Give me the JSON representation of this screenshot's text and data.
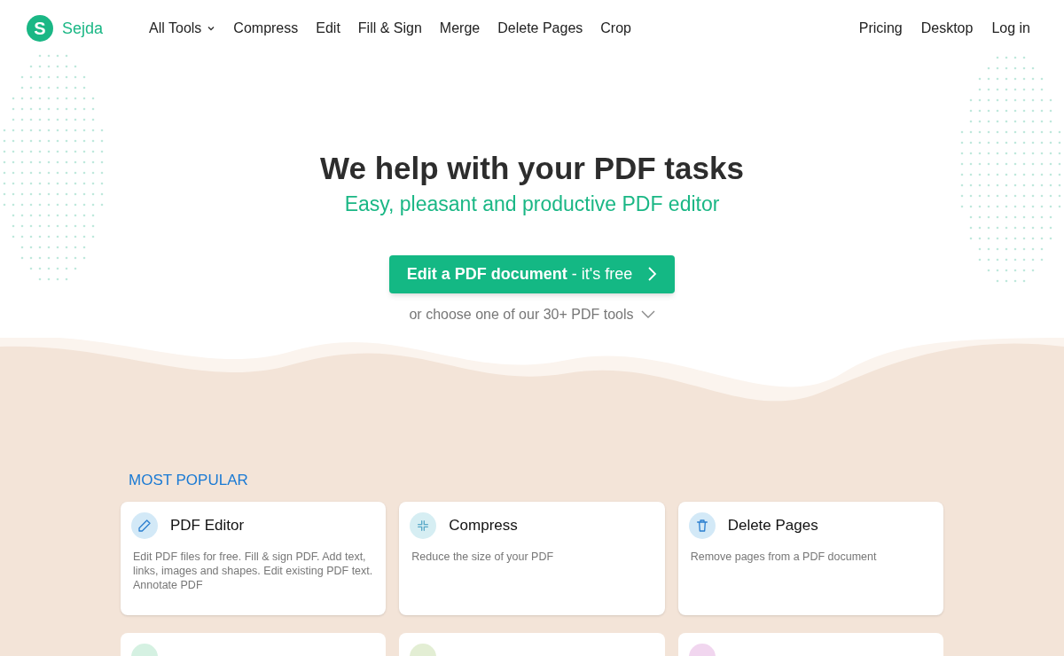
{
  "logo": {
    "text": "Sejda",
    "letter": "S"
  },
  "nav": [
    {
      "label": "All Tools",
      "dropdown": true
    },
    {
      "label": "Compress",
      "dropdown": false
    },
    {
      "label": "Edit",
      "dropdown": false
    },
    {
      "label": "Fill & Sign",
      "dropdown": false
    },
    {
      "label": "Merge",
      "dropdown": false
    },
    {
      "label": "Delete Pages",
      "dropdown": false
    },
    {
      "label": "Crop",
      "dropdown": false
    }
  ],
  "nav_right": [
    "Pricing",
    "Desktop",
    "Log in"
  ],
  "hero": {
    "title": "We help with your PDF tasks",
    "subtitle": "Easy, pleasant and productive PDF editor",
    "cta": "**Edit a PDF document** - it's free",
    "more": "or choose one of our 30+ PDF tools"
  },
  "section_title": "MOST POPULAR",
  "cards": [
    {
      "kind": "pencil",
      "title": "PDF Editor",
      "description": "Edit PDF files for free. Fill & sign PDF. Add text, links, images and shapes. Edit existing PDF text. Annotate PDF",
      "color": "#d3e9f7"
    },
    {
      "kind": "compress",
      "title": "Compress",
      "description": "Reduce the size of your PDF",
      "color": "#d6eef3"
    },
    {
      "kind": "trash",
      "title": "Delete Pages",
      "description": "Remove pages from a PDF document",
      "color": "#d3e9f7"
    }
  ],
  "cards_partial": [
    {
      "color": "#d5f1e2"
    },
    {
      "color": "#e3eed4"
    },
    {
      "color": "#f1d6ef"
    }
  ]
}
